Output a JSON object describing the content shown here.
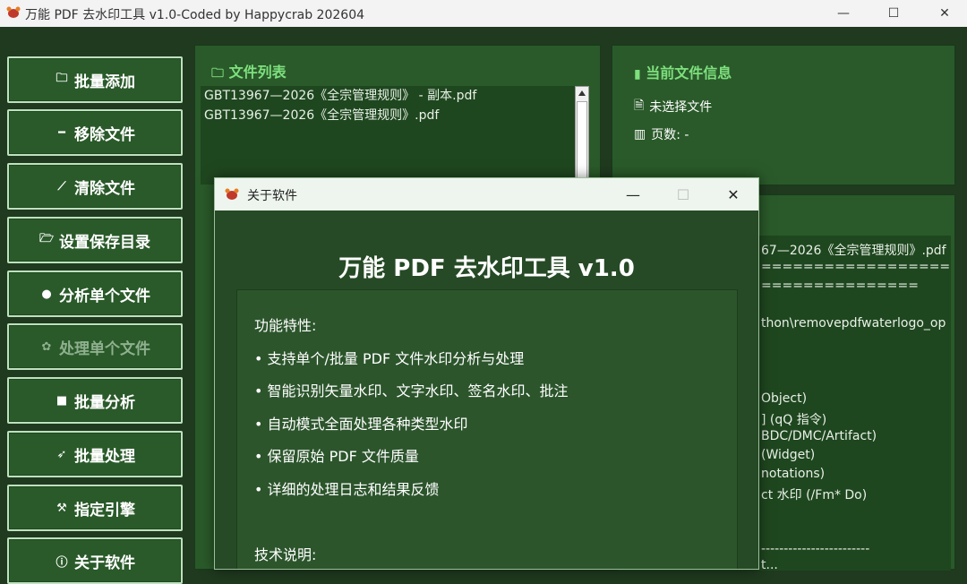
{
  "window": {
    "title": "万能 PDF 去水印工具 v1.0-Coded by Happycrab 202604",
    "minimize": "—",
    "maximize": "☐",
    "close": "✕"
  },
  "sidebar": {
    "items": [
      {
        "label": "批量添加",
        "icon": "folder-icon",
        "glyph": "🗀"
      },
      {
        "label": "移除文件",
        "icon": "minus-icon",
        "glyph": "━"
      },
      {
        "label": "清除文件",
        "icon": "brush-icon",
        "glyph": "⟋"
      },
      {
        "label": "设置保存目录",
        "icon": "folder-open-icon",
        "glyph": "🗁"
      },
      {
        "label": "分析单个文件",
        "icon": "search-icon",
        "glyph": "●"
      },
      {
        "label": "处理单个文件",
        "icon": "gear-icon",
        "glyph": "✿"
      },
      {
        "label": "批量分析",
        "icon": "save-icon",
        "glyph": "■"
      },
      {
        "label": "批量处理",
        "icon": "rocket-icon",
        "glyph": "➶"
      },
      {
        "label": "指定引擎",
        "icon": "wrench-icon",
        "glyph": "⚒"
      },
      {
        "label": "关于软件",
        "icon": "info-icon",
        "glyph": "ⓘ"
      }
    ]
  },
  "file_list": {
    "title": "文件列表",
    "files": [
      "GBT13967—2026《全宗管理规则》 - 副本.pdf",
      "GBT13967—2026《全宗管理规则》.pdf"
    ]
  },
  "file_info": {
    "title": "当前文件信息",
    "file_label": "未选择文件",
    "pages_label": "页数: -"
  },
  "log": {
    "lines": [
      "67—2026《全宗管理规则》.pdf",
      "========================",
      "===============",
      "thon\\removepdfwaterlogo_op",
      "Object)",
      "] (qQ 指令)",
      "BDC/DMC/Artifact)",
      " (Widget)",
      "notations)",
      "ct 水印 (/Fm* Do)",
      "------------------------",
      "t..."
    ]
  },
  "about": {
    "title": "关于软件",
    "heading": "万能 PDF 去水印工具 v1.0",
    "features_title": "功能特性:",
    "features": [
      "• 支持单个/批量 PDF 文件水印分析与处理",
      "• 智能识别矢量水印、文字水印、签名水印、批注",
      "• 自动模式全面处理各种类型水印",
      "• 保留原始 PDF 文件质量",
      "• 详细的处理日志和结果反馈"
    ],
    "tech_title": "技术说明:"
  },
  "colors": {
    "bg": "#1f3a1f",
    "panel": "#2a5a2a",
    "accent": "#7ee07e"
  }
}
